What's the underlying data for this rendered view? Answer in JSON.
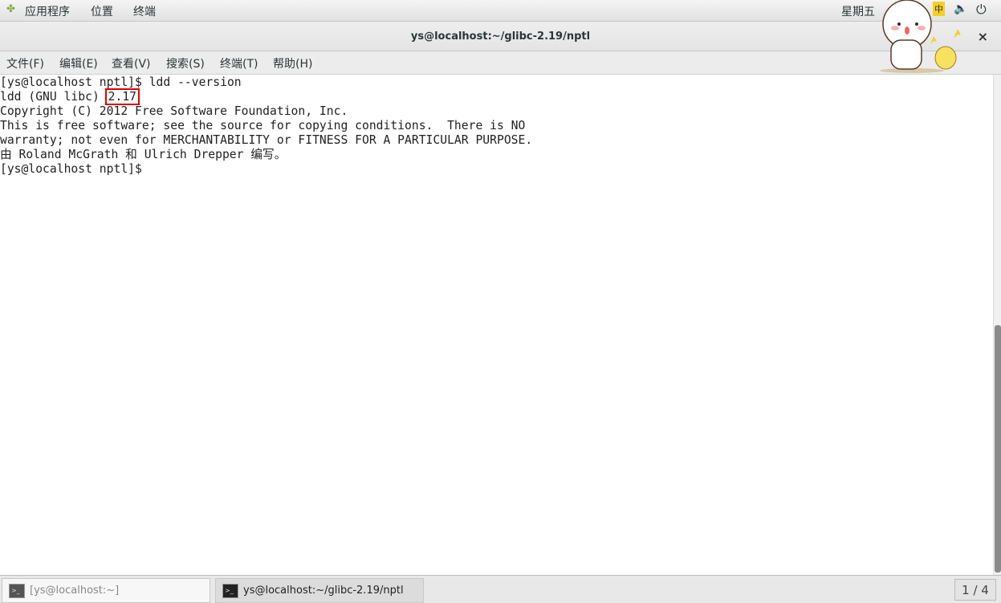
{
  "topbar": {
    "applications": "应用程序",
    "places": "位置",
    "terminal": "终端",
    "clock": "星期五",
    "ime": "中"
  },
  "window": {
    "title": "ys@localhost:~/glibc-2.19/nptl",
    "close": "×"
  },
  "menu": [
    "文件(F)",
    "编辑(E)",
    "查看(V)",
    "搜索(S)",
    "终端(T)",
    "帮助(H)"
  ],
  "terminal": {
    "lines": [
      "[ys@localhost nptl]$ ldd --version",
      "ldd (GNU libc) ",
      "Copyright (C) 2012 Free Software Foundation, Inc.",
      "This is free software; see the source for copying conditions.  There is NO",
      "warranty; not even for MERCHANTABILITY or FITNESS FOR A PARTICULAR PURPOSE.",
      "由 Roland McGrath 和 Ulrich Drepper 编写。",
      "[ys@localhost nptl]$ "
    ],
    "version_highlight": "2.17",
    "highlight_color": "#e00000"
  },
  "taskbar": {
    "tasks": [
      "[ys@localhost:~]",
      "ys@localhost:~/glibc-2.19/nptl"
    ],
    "pager": "1 / 4"
  }
}
